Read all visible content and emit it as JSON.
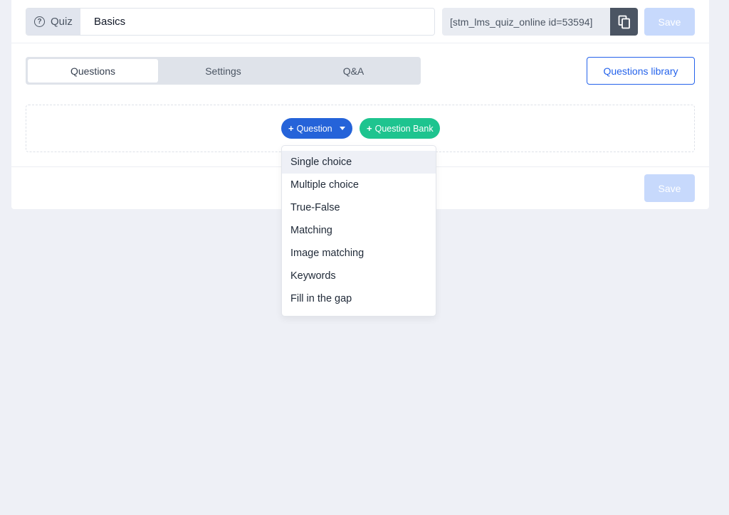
{
  "header": {
    "quiz_prefix_label": "Quiz",
    "quiz_title_value": "Basics",
    "shortcode": "[stm_lms_quiz_online id=53594]",
    "save_label": "Save"
  },
  "tabs": [
    {
      "label": "Questions",
      "active": true
    },
    {
      "label": "Settings",
      "active": false
    },
    {
      "label": "Q&A",
      "active": false
    }
  ],
  "questions_library_label": "Questions library",
  "add_buttons": {
    "question_label": "Question",
    "question_bank_label": "Question Bank"
  },
  "question_types_menu": [
    "Single choice",
    "Multiple choice",
    "True-False",
    "Matching",
    "Image matching",
    "Keywords",
    "Fill in the gap"
  ],
  "footer": {
    "save_label": "Save"
  },
  "colors": {
    "primary": "#2563d9",
    "success": "#1ec48f",
    "save_disabled": "#c7d9fc",
    "background": "#eef0f6"
  }
}
